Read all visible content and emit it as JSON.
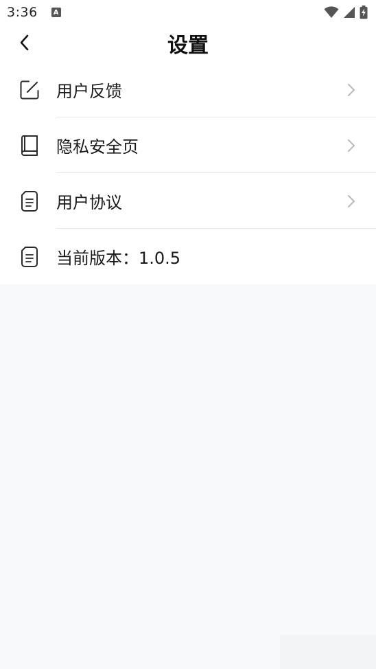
{
  "status_bar": {
    "time": "3:36",
    "notification_glyph": "A",
    "icons": [
      "wifi-icon",
      "signal-icon",
      "battery-charging-icon"
    ]
  },
  "header": {
    "title": "设置",
    "back_icon": "chevron-left-icon"
  },
  "settings": {
    "items": [
      {
        "label": "用户反馈",
        "icon": "edit-icon",
        "has_chevron": true
      },
      {
        "label": "隐私安全页",
        "icon": "book-icon",
        "has_chevron": true
      },
      {
        "label": "用户协议",
        "icon": "document-icon",
        "has_chevron": true
      },
      {
        "label": "当前版本：1.0.5",
        "icon": "document-icon",
        "has_chevron": false
      }
    ]
  },
  "colors": {
    "background": "#f8f9fb",
    "surface": "#ffffff",
    "divider": "#e8e8e8",
    "chevron": "#b8b8b8",
    "icon_stroke": "#2a2a2a"
  }
}
